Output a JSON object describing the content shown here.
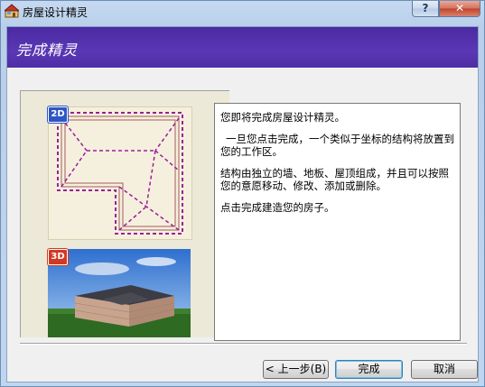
{
  "window": {
    "title": "房屋设计精灵",
    "help_label": "?",
    "close_label": "✕"
  },
  "banner": {
    "title": "完成精灵"
  },
  "preview": {
    "badge_2d": "2D",
    "badge_3d": "3D"
  },
  "message": {
    "p1": "您即将完成房屋设计精灵。",
    "p2": "一旦您点击完成，一个类似于坐标的结构将放置到您的工作区。",
    "p3": "结构由独立的墙、地板、屋顶组成，并且可以按照您的意愿移动、修改、添加或删除。",
    "p4": "点击完成建造您的房子。"
  },
  "buttons": {
    "back": "< 上一步(B)",
    "finish": "完成",
    "cancel": "取消"
  },
  "colors": {
    "banner": "#5b37b5",
    "plan_outline": "#9b1f9b",
    "badge_2d": "#2d55c4",
    "badge_3d": "#d03a25"
  }
}
